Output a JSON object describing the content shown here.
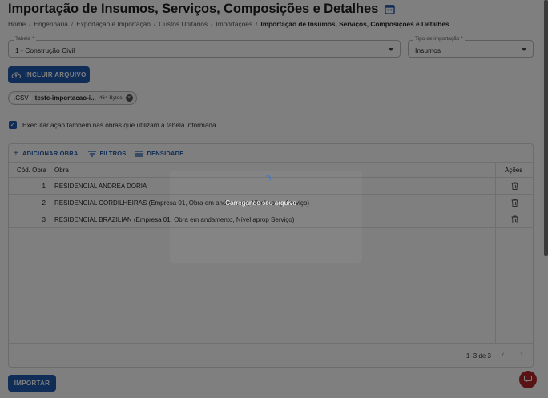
{
  "header": {
    "title": "Importação de Insumos, Serviços, Composições e Detalhes",
    "title_icon": "calendar-icon"
  },
  "breadcrumb": [
    "Home",
    "Engenharia",
    "Exportação e Importação",
    "Custos Unitários",
    "Importações",
    "Importação de Insumos, Serviços, Composições e Detalhes"
  ],
  "form": {
    "tabela_label": "Tabela *",
    "tabela_value": "1 - Construção Civil",
    "tipo_label": "Tipo de importação *",
    "tipo_value": "Insumos",
    "include_button": "INCLUIR ARQUIVO",
    "file_chip": {
      "extension": ".CSV",
      "name": "teste-importacao-i...",
      "size": "464 Bytes"
    },
    "checkbox_label": "Executar ação também nas obras que utilizam a tabela informada",
    "checkbox_checked": true
  },
  "grid": {
    "toolbar": {
      "add": "ADICIONAR OBRA",
      "filters": "FILTROS",
      "density": "DENSIDADE"
    },
    "columns": {
      "code": "Cód. Obra",
      "name": "Obra",
      "actions": "Ações"
    },
    "rows": [
      {
        "code": "1",
        "name": "RESIDENCIAL ANDREA DORIA"
      },
      {
        "code": "2",
        "name": "RESIDENCIAL CORDILHEIRAS (Empresa 01, Obra em andamento, Nível aprop Serviço)"
      },
      {
        "code": "3",
        "name": "RESIDENCIAL BRAZILIAN (Empresa 01, Obra em andamento, Nível aprop Serviço)"
      }
    ],
    "pagination": "1–3 de 3"
  },
  "footer": {
    "import_button": "IMPORTAR"
  },
  "loading": {
    "text": "Carregando seu arquivo"
  },
  "colors": {
    "primary": "#1f5aad",
    "fab": "#b3262a"
  }
}
